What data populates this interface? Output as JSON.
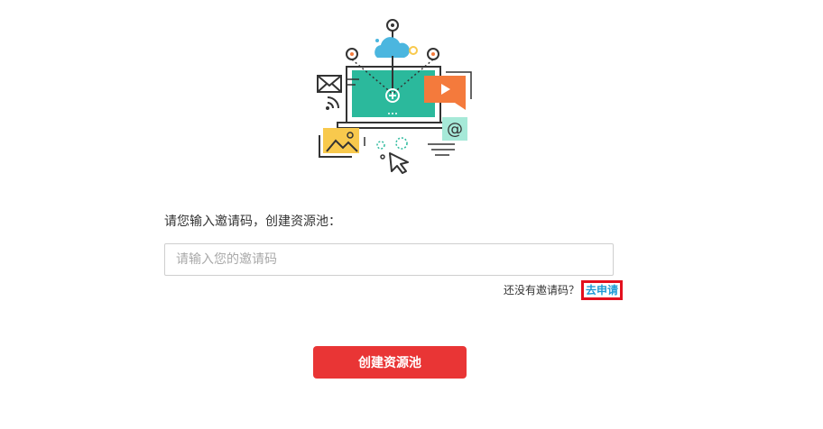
{
  "form": {
    "prompt_label": "请您输入邀请码，创建资源池：",
    "input_placeholder": "请输入您的邀请码",
    "input_value": "",
    "no_code_hint": "还没有邀请码？",
    "apply_link_label": "去申请",
    "create_button_label": "创建资源池"
  },
  "illustration": {
    "name": "network-laptop-illustration",
    "icons": [
      "cloud-icon",
      "mail-icon",
      "wifi-icon",
      "video-play-icon",
      "at-sign-icon",
      "image-icon",
      "cursor-icon",
      "laptop-icon"
    ]
  },
  "colors": {
    "primary_button": "#e93535",
    "link": "#1e9ad6",
    "highlight_box": "#e3101e",
    "screen_teal": "#2bb99c",
    "video_orange": "#f47a3c",
    "cloud_blue": "#4bb6df",
    "image_yellow": "#f8c94d",
    "at_mint": "#a6e9d8"
  }
}
